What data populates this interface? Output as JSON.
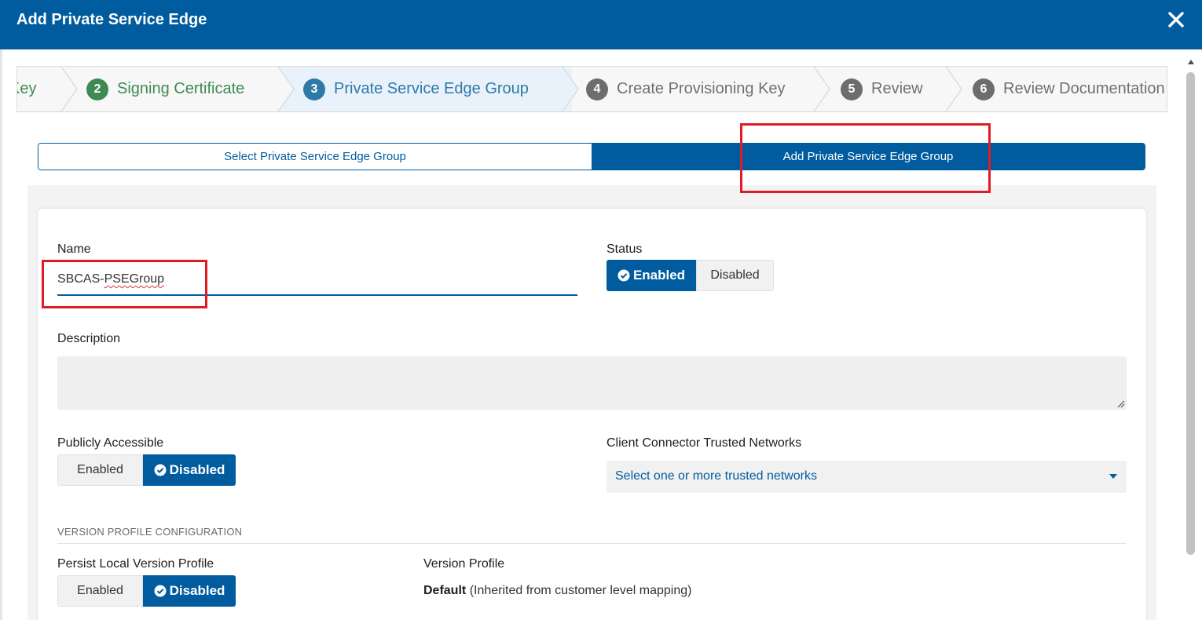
{
  "dialog": {
    "title": "Add Private Service Edge"
  },
  "wizard": {
    "steps": [
      {
        "num": "",
        "label": "Key"
      },
      {
        "num": "2",
        "label": "Signing Certificate"
      },
      {
        "num": "3",
        "label": "Private Service Edge Group"
      },
      {
        "num": "4",
        "label": "Create Provisioning Key"
      },
      {
        "num": "5",
        "label": "Review"
      },
      {
        "num": "6",
        "label": "Review Documentation"
      }
    ]
  },
  "mode_toggle": {
    "select_label": "Select Private Service Edge Group",
    "add_label": "Add Private Service Edge Group"
  },
  "form": {
    "name_label": "Name",
    "name_prefix": "SBCAS-",
    "name_suffix": "PSEGroup",
    "status_label": "Status",
    "status_enabled": "Enabled",
    "status_disabled": "Disabled",
    "description_label": "Description",
    "public_label": "Publicly Accessible",
    "public_enabled": "Enabled",
    "public_disabled": "Disabled",
    "trusted_label": "Client Connector Trusted Networks",
    "trusted_placeholder": "Select one or more trusted networks",
    "version_section": "VERSION PROFILE CONFIGURATION",
    "persist_label": "Persist Local Version Profile",
    "persist_enabled": "Enabled",
    "persist_disabled": "Disabled",
    "version_profile_label": "Version Profile",
    "version_profile_value": "Default",
    "version_profile_note": "(Inherited from customer level mapping)"
  },
  "colors": {
    "primary": "#005c9e",
    "step_done": "#3e8a52",
    "highlight": "#e01b24"
  }
}
